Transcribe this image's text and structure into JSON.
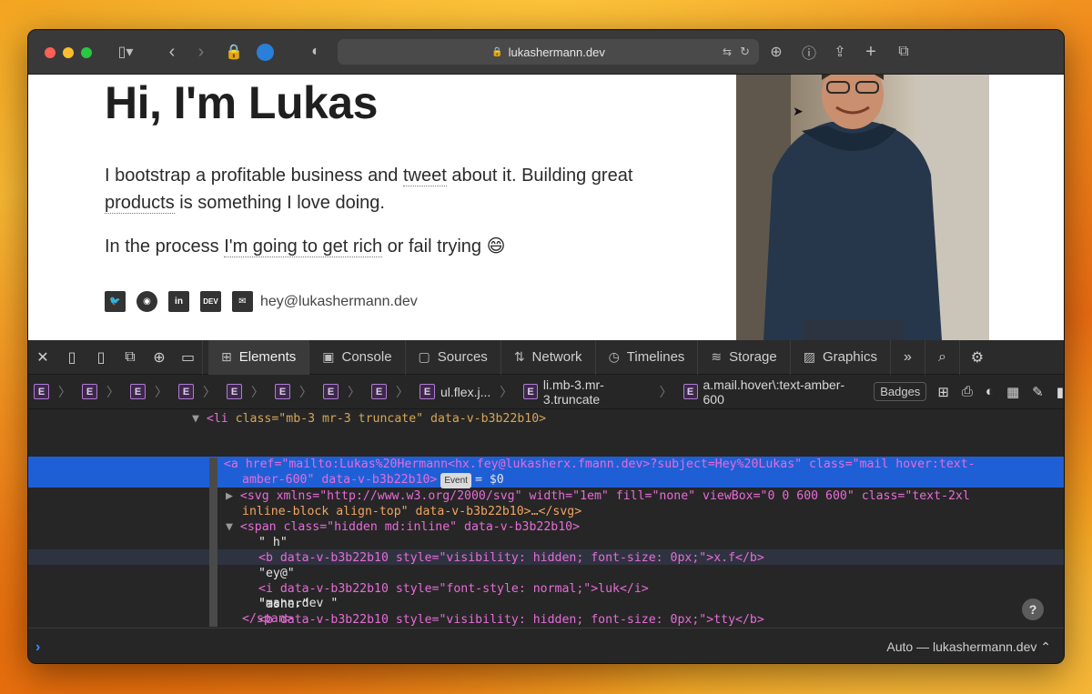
{
  "browser": {
    "url": "lukashermann.dev",
    "traffic_light_colors": [
      "#ff5f57",
      "#febc2e",
      "#28c840"
    ]
  },
  "page": {
    "heading": "Hi, I'm Lukas",
    "para1_a": "I bootstrap a profitable business and ",
    "para1_link1": "tweet",
    "para1_b": " about it. Building great ",
    "para1_link2": "products",
    "para1_c": " is something I love doing.",
    "para2_a": "In the process ",
    "para2_link": "I'm going to get rich",
    "para2_b": " or fail trying 😄",
    "dev_badge": "DEV",
    "email": "hey@lukashermann.dev"
  },
  "devtools": {
    "tabs": [
      {
        "label": "Elements",
        "icon": "elements-icon"
      },
      {
        "label": "Console",
        "icon": "console-icon"
      },
      {
        "label": "Sources",
        "icon": "sources-icon"
      },
      {
        "label": "Network",
        "icon": "network-icon"
      },
      {
        "label": "Timelines",
        "icon": "timelines-icon"
      },
      {
        "label": "Storage",
        "icon": "storage-icon"
      },
      {
        "label": "Graphics",
        "icon": "graphics-icon"
      }
    ],
    "breadcrumb": {
      "e": "E",
      "crumb1": "ul.flex.j...",
      "crumb2": "li.mb-3.mr-3.truncate",
      "crumb3": "a.mail.hover\\:text-amber-600",
      "badges": "Badges"
    },
    "dom": {
      "l1_tag": "<li",
      "l1_attrs": " class=\"mb-3 mr-3 truncate\" data-v-b3b22b10>",
      "l2_a": "<a href=\"mailto:Lukas%20Hermann<hx.fey@lukasherx.fmann.dev>?subject=Hey%20Lukas\" class=\"mail hover:text-",
      "l2_b": "amber-600\" data-v-b3b22b10>",
      "l2_event": "Event",
      "l2_var": "= $0",
      "l3_a": "<svg xmlns=\"http://www.w3.org/2000/svg\" width=\"1em\" fill=\"none\" viewBox=\"0 0 600 600\" class=\"text-2xl",
      "l3_b": "inline-block align-top\" data-v-b3b22b10>…</svg>",
      "l4": "<span class=\"hidden md:inline\" data-v-b3b22b10>",
      "l5": "\" h\"",
      "l6": "<b data-v-b3b22b10 style=\"visibility: hidden; font-size: 0px;\">x.f</b>",
      "l7": "\"ey@\"",
      "l8": "<i data-v-b3b22b10 style=\"font-style: normal;\">luk</i>",
      "l9": "\"asher\"",
      "l10": "<b data-v-b3b22b10 style=\"visibility: hidden; font-size: 0px;\">tty</b>",
      "l11": "\"mann.dev \"",
      "l12": "</span>"
    },
    "console_context": "Auto — lukashermann.dev ⌃",
    "console_prompt": "›",
    "help": "?"
  },
  "colors": {
    "selection": "#1f5fd6",
    "tag": "#e76cd8",
    "attr_name": "#d8a657",
    "attr_value": "#f2a55f"
  }
}
